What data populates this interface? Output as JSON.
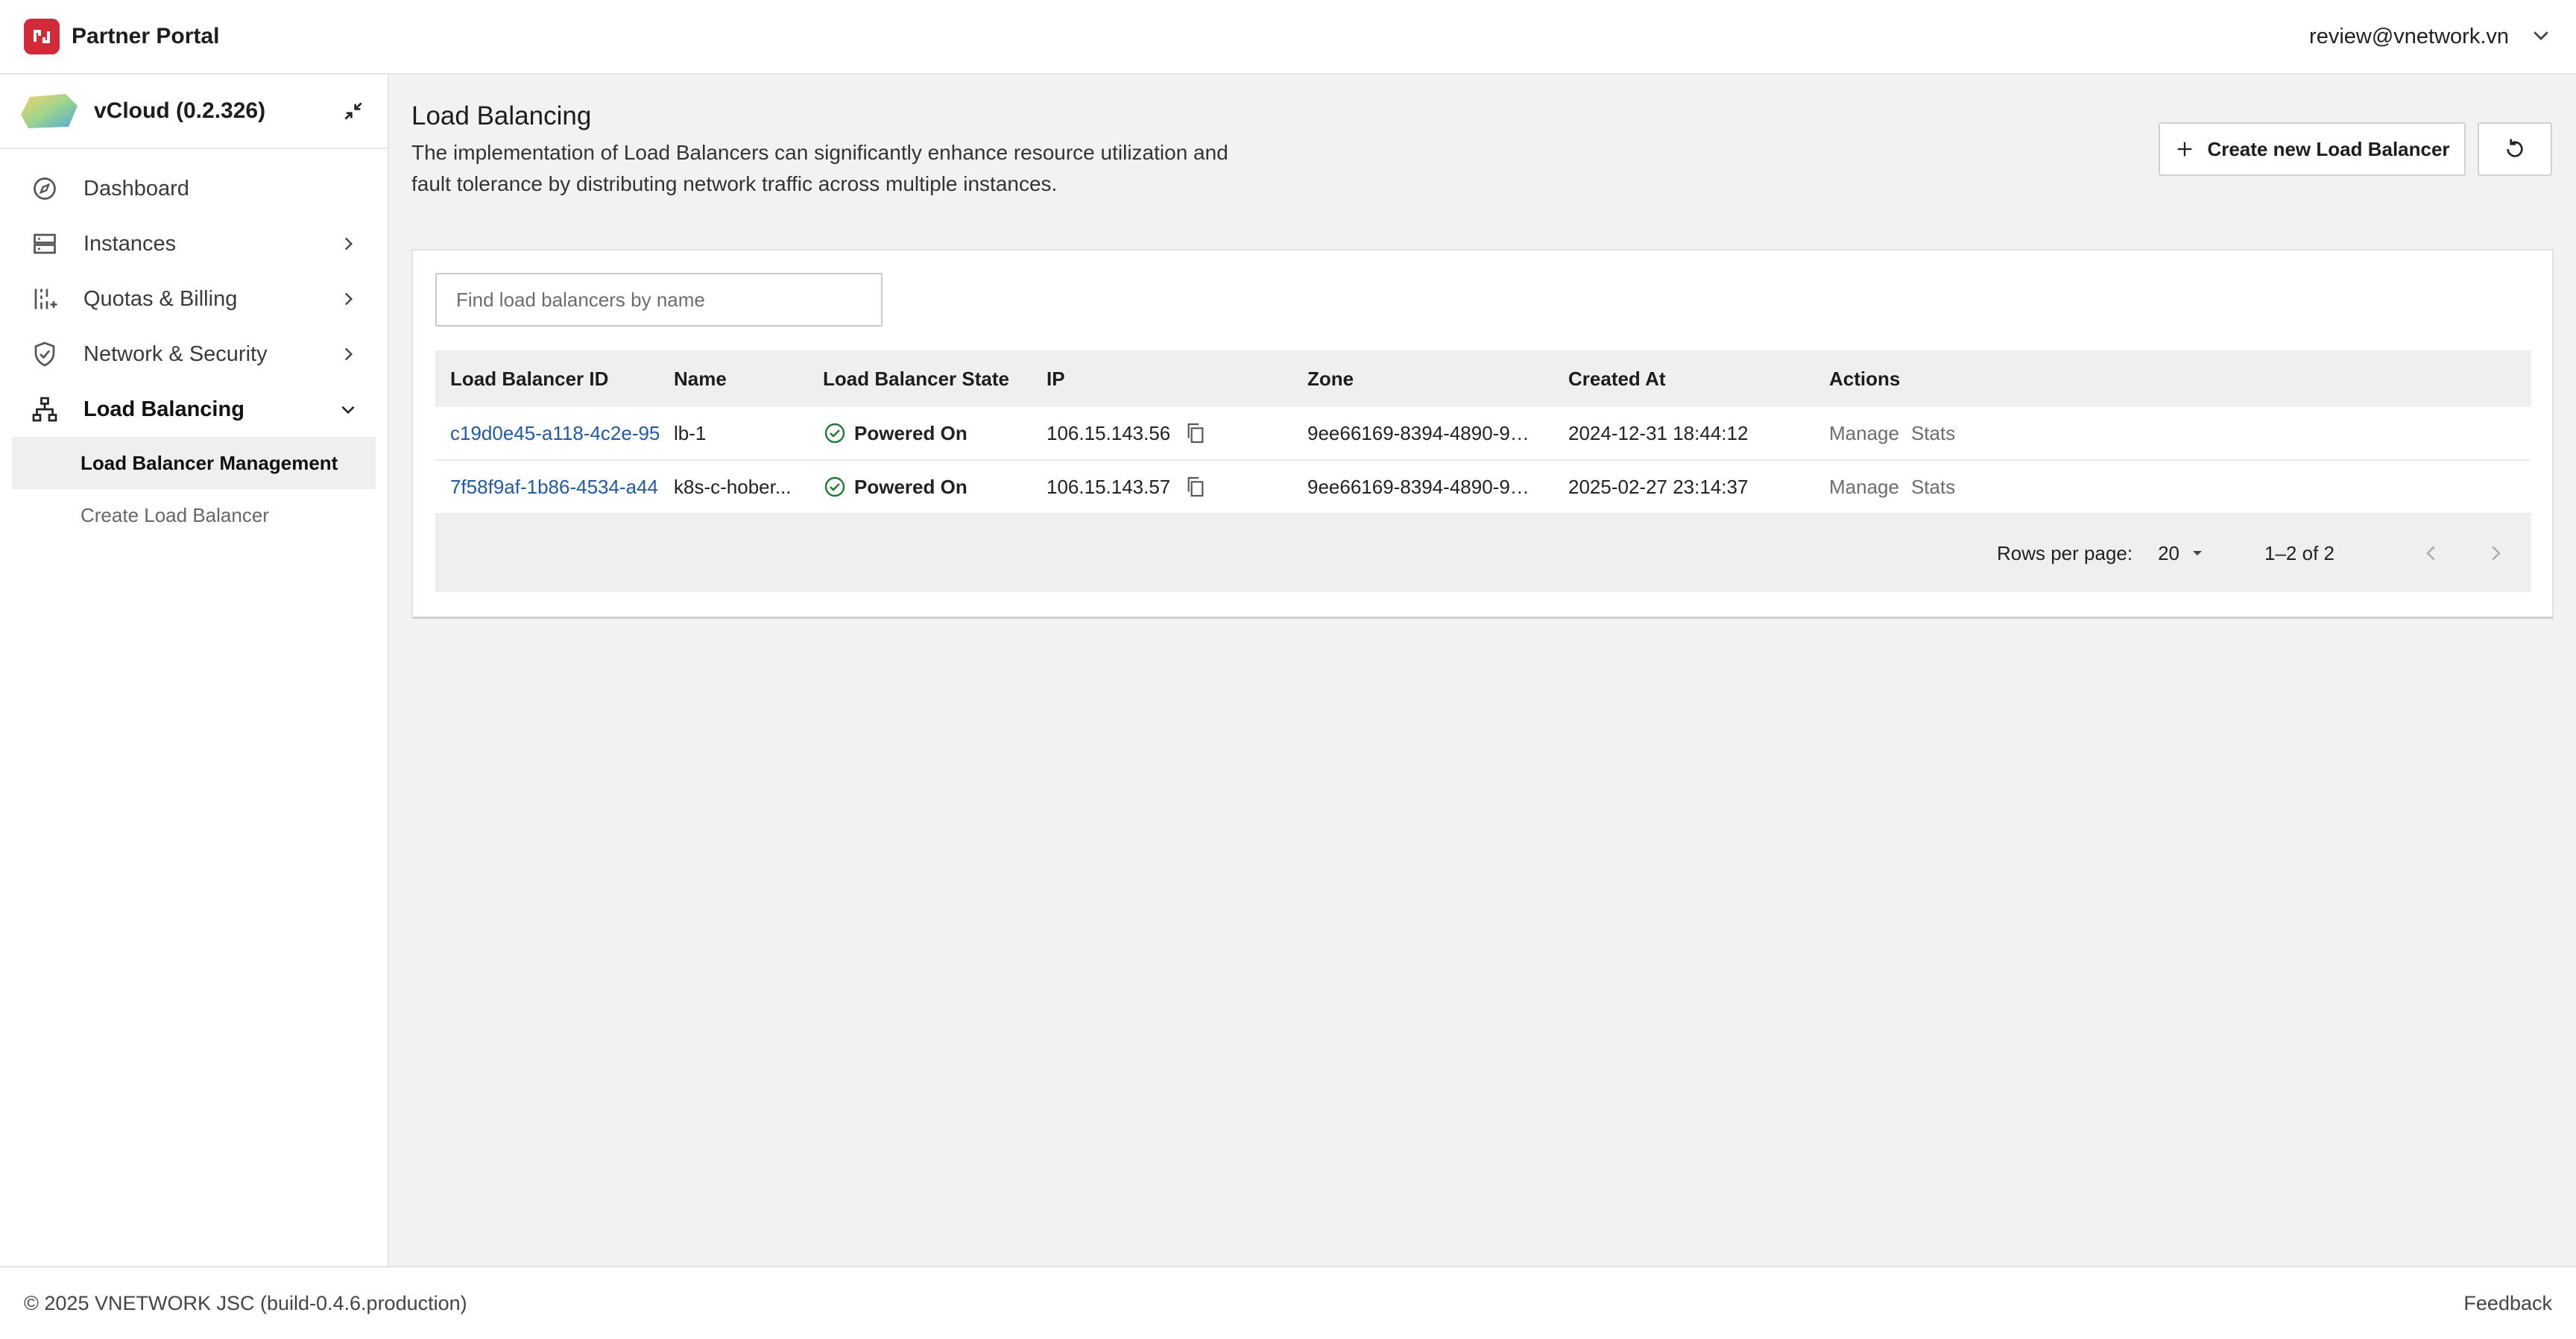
{
  "header": {
    "brand": "Partner Portal",
    "user_email": "review@vnetwork.vn"
  },
  "sidebar": {
    "org_name": "vCloud (0.2.326)",
    "items": [
      {
        "label": "Dashboard",
        "icon": "compass-icon"
      },
      {
        "label": "Instances",
        "icon": "server-icon"
      },
      {
        "label": "Quotas & Billing",
        "icon": "quota-icon"
      },
      {
        "label": "Network & Security",
        "icon": "shield-icon"
      },
      {
        "label": "Load Balancing",
        "icon": "sitemap-icon"
      }
    ],
    "sub_items": [
      {
        "label": "Load Balancer Management"
      },
      {
        "label": "Create Load Balancer"
      }
    ]
  },
  "main": {
    "title": "Load Balancing",
    "description": "The implementation of Load Balancers can significantly enhance resource utilization and fault tolerance by distributing network traffic across multiple instances.",
    "create_label": "Create new Load Balancer"
  },
  "search": {
    "placeholder": "Find load balancers by name",
    "value": ""
  },
  "table": {
    "headers": [
      "Load Balancer ID",
      "Name",
      "Load Balancer State",
      "IP",
      "Zone",
      "Created At",
      "Actions"
    ],
    "rows": [
      {
        "id": "c19d0e45-a118-4c2e-95",
        "name": "lb-1",
        "state": "Powered On",
        "ip": "106.15.143.56",
        "zone": "9ee66169-8394-4890-93...",
        "created": "2024-12-31 18:44:12",
        "action_manage": "Manage",
        "action_stats": "Stats"
      },
      {
        "id": "7f58f9af-1b86-4534-a44",
        "name": "k8s-c-hober...",
        "state": "Powered On",
        "ip": "106.15.143.57",
        "zone": "9ee66169-8394-4890-93...",
        "created": "2025-02-27 23:14:37",
        "action_manage": "Manage",
        "action_stats": "Stats"
      }
    ],
    "footer": {
      "rows_per_page_label": "Rows per page:",
      "rows_per_page": "20",
      "range": "1–2 of 2"
    }
  },
  "footer": {
    "copyright": "© 2025 VNETWORK JSC (build-0.4.6.production)",
    "feedback": "Feedback"
  },
  "colors": {
    "brand": "#d32a3a",
    "link": "#1f5aa6",
    "success": "#1e7a36"
  }
}
